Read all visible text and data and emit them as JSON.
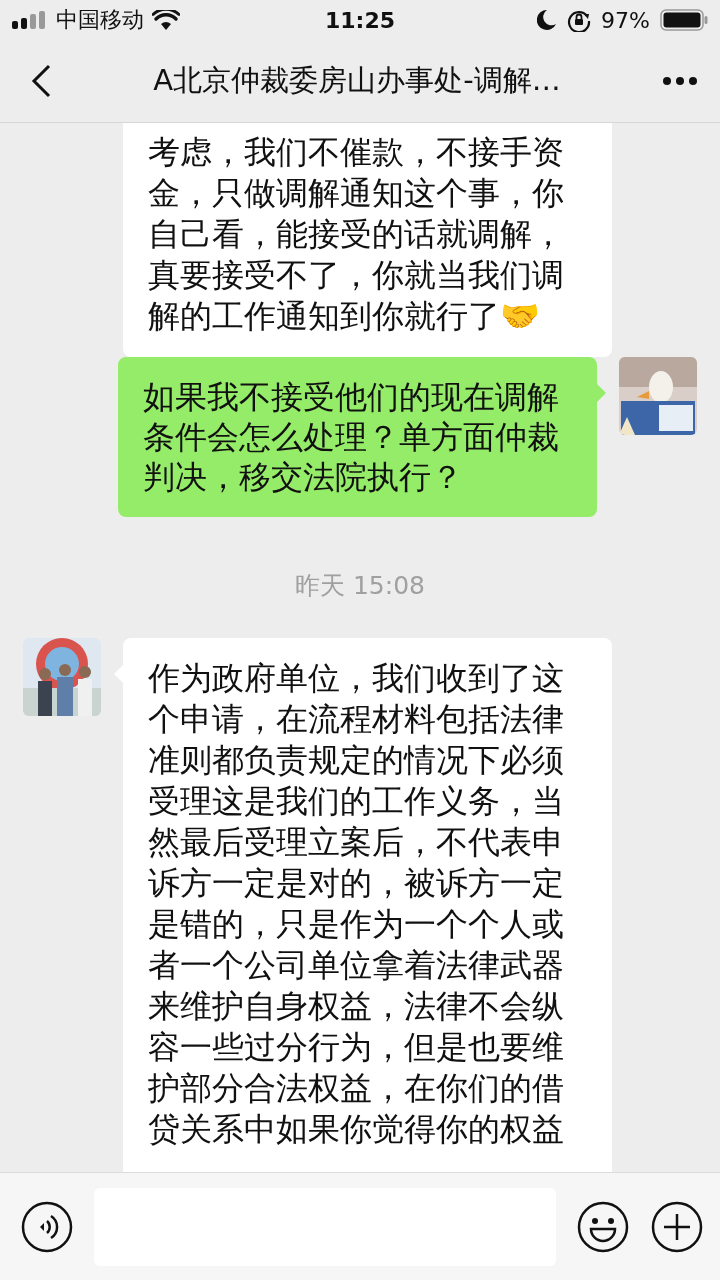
{
  "status_bar": {
    "carrier": "中国移动",
    "time": "11:25",
    "battery": "97%"
  },
  "header": {
    "title": "A北京仲裁委房山办事处-调解…"
  },
  "messages": [
    {
      "kind": "incoming",
      "avatar": false,
      "text": "考虑，我们不催款，不接手资金，只做调解通知这个事，你自己看，能接受的话就调解，真要接受不了，你就当我们调解的工作通知到你就行了🤝"
    },
    {
      "kind": "outgoing",
      "avatar": true,
      "text": "如果我不接受他们的现在调解条件会怎么处理？单方面仲裁判决，移交法院执行？"
    },
    {
      "kind": "time",
      "text": "昨天 15:08"
    },
    {
      "kind": "incoming",
      "avatar": true,
      "text": "作为政府单位，我们收到了这个申请，在流程材料包括法律准则都负责规定的情况下必须受理这是我们的工作义务，当然最后受理立案后，不代表申诉方一定是对的，被诉方一定是错的，只是作为一个个人或者一个公司单位拿着法律武器来维护自身权益，法律不会纵容一些过分行为，但是也要维护部分合法权益，在你们的借贷关系中如果你觉得你的权益"
    }
  ]
}
